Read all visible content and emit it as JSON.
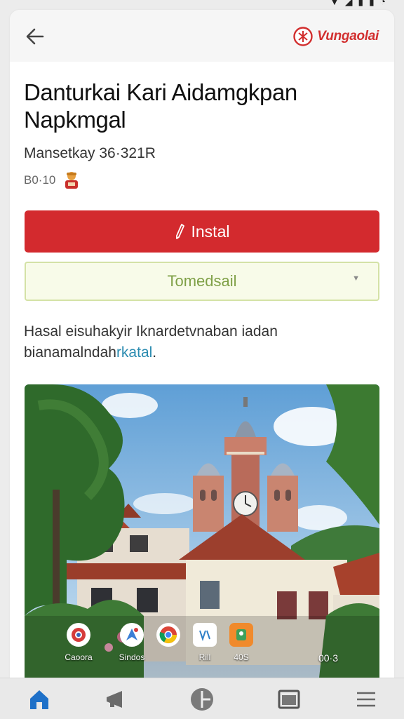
{
  "brand": {
    "name": "Vungaolai",
    "accent": "#d22f2f"
  },
  "app": {
    "title": "Danturkai Kari Aidamgkpan Napkmgal",
    "meta": "Mansetkay 36·321R",
    "size": "B0·10"
  },
  "actions": {
    "install_label": "Instal",
    "install_color": "#d32a2e",
    "dropdown_value": "Tomedsail"
  },
  "description": {
    "text": "Hasal eisuhakyir Iknardetvnaban iadan bianamalndah",
    "link_text": "rkatal",
    "tail": "."
  },
  "screenshot_dock": [
    {
      "label": "Caoora",
      "icon": "camera-app-icon"
    },
    {
      "label": "Sindos",
      "icon": "maps-app-icon"
    },
    {
      "label": "",
      "icon": "chrome-app-icon"
    },
    {
      "label": "Rill",
      "icon": "notes-app-icon"
    },
    {
      "label": "40S",
      "icon": "contacts-app-icon"
    },
    {
      "label": "00·3",
      "icon": "clock-app-icon"
    }
  ],
  "bottom_nav": [
    {
      "name": "home",
      "icon": "home-icon",
      "active": true
    },
    {
      "name": "send",
      "icon": "megaphone-icon"
    },
    {
      "name": "apps",
      "icon": "pie-icon"
    },
    {
      "name": "window",
      "icon": "window-icon"
    },
    {
      "name": "menu",
      "icon": "menu-icon"
    }
  ]
}
